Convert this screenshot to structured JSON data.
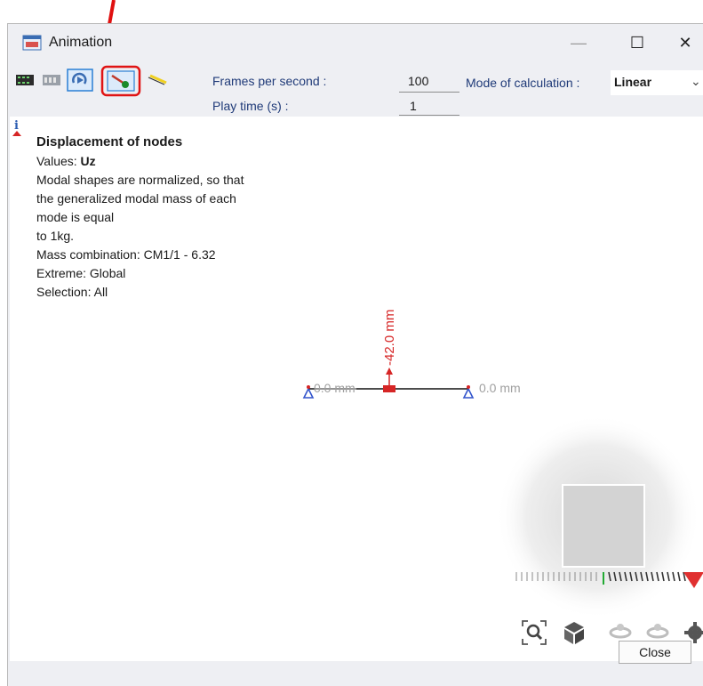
{
  "window": {
    "title": "Animation",
    "minimize_glyph": "—",
    "maximize_glyph": "☐",
    "close_glyph": "✕"
  },
  "toolbar": {
    "icons": [
      "film-strip-icon",
      "frames-icon",
      "loop-play-icon",
      "deformed-shape-icon",
      "undeformed-shape-icon"
    ],
    "fps_label": "Frames per second :",
    "fps_value": "100",
    "playtime_label": "Play time (s) :",
    "playtime_value": "1",
    "mode_label": "Mode of calculation :",
    "mode_value": "Linear"
  },
  "info": {
    "heading": "Displacement  of nodes",
    "values_label": "Values: ",
    "values_value": "Uz",
    "lines": [
      "Modal shapes are normalized, so that",
      "the generalized modal mass of each",
      "mode is equal",
      "to 1kg.",
      "Mass combination:  CM1/1 - 6.32",
      "Extreme: Global",
      "Selection: All"
    ]
  },
  "model": {
    "left_label": "0.0 mm",
    "right_label": "0.0 mm",
    "mid_label": "-42.0 mm"
  },
  "bottom_icons": [
    "zoom-fit-icon",
    "view-cube-icon",
    "rotate-left-icon",
    "rotate-right-icon",
    "settings-icon"
  ],
  "buttons": {
    "close": "Close"
  },
  "colors": {
    "accent_red": "#d62525",
    "support_blue": "#3355cc",
    "highlight_blue": "#2a7fd4"
  }
}
